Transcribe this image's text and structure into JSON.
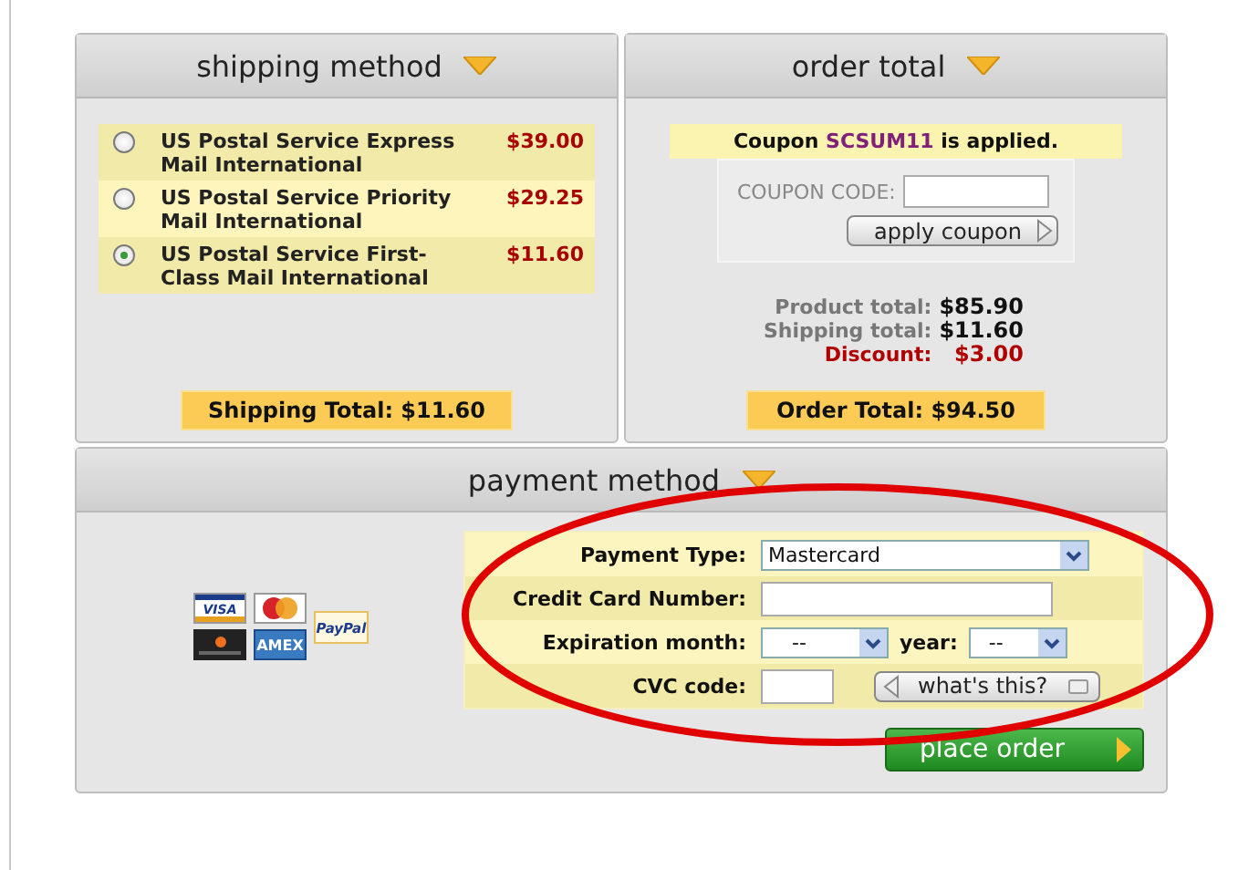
{
  "shipping": {
    "title": "shipping method",
    "options": [
      {
        "name": "US Postal Service Express Mail International",
        "price": "$39.00",
        "selected": false
      },
      {
        "name": "US Postal Service Priority Mail International",
        "price": "$29.25",
        "selected": false
      },
      {
        "name": "US Postal Service First-Class Mail International",
        "price": "$11.60",
        "selected": true
      }
    ],
    "total": "Shipping Total: $11.60"
  },
  "order_total": {
    "title": "order total",
    "coupon_notice": "Coupon **SCSUM11** is applied.",
    "coupon_label": "COUPON CODE:",
    "apply_button": "apply coupon",
    "lines": [
      {
        "label": "Product total:",
        "value": "$85.90",
        "kind": "normal"
      },
      {
        "label": "Shipping total:",
        "value": "$11.60",
        "kind": "normal"
      },
      {
        "label": "Discount:",
        "value": "$3.00",
        "kind": "discount"
      }
    ],
    "total": "Order Total: $94.50"
  },
  "payment": {
    "title": "payment method",
    "card_logos": [
      {
        "kind": "visa",
        "label": "VISA"
      },
      {
        "kind": "mastercard"
      },
      {
        "kind": "discover"
      },
      {
        "kind": "amex",
        "label": "AMEX"
      },
      {
        "kind": "paypal",
        "label": "PayPal"
      }
    ],
    "payment_type_label": "Payment Type:",
    "payment_type": "Mastercard",
    "card_number_label": "Credit Card Number:",
    "expiration_label": "Expiration month:",
    "month": "--",
    "year_label": "year:",
    "year": "--",
    "cvc_label": "CVC code:",
    "whats_this": "what's this?",
    "place_order": "place order"
  }
}
